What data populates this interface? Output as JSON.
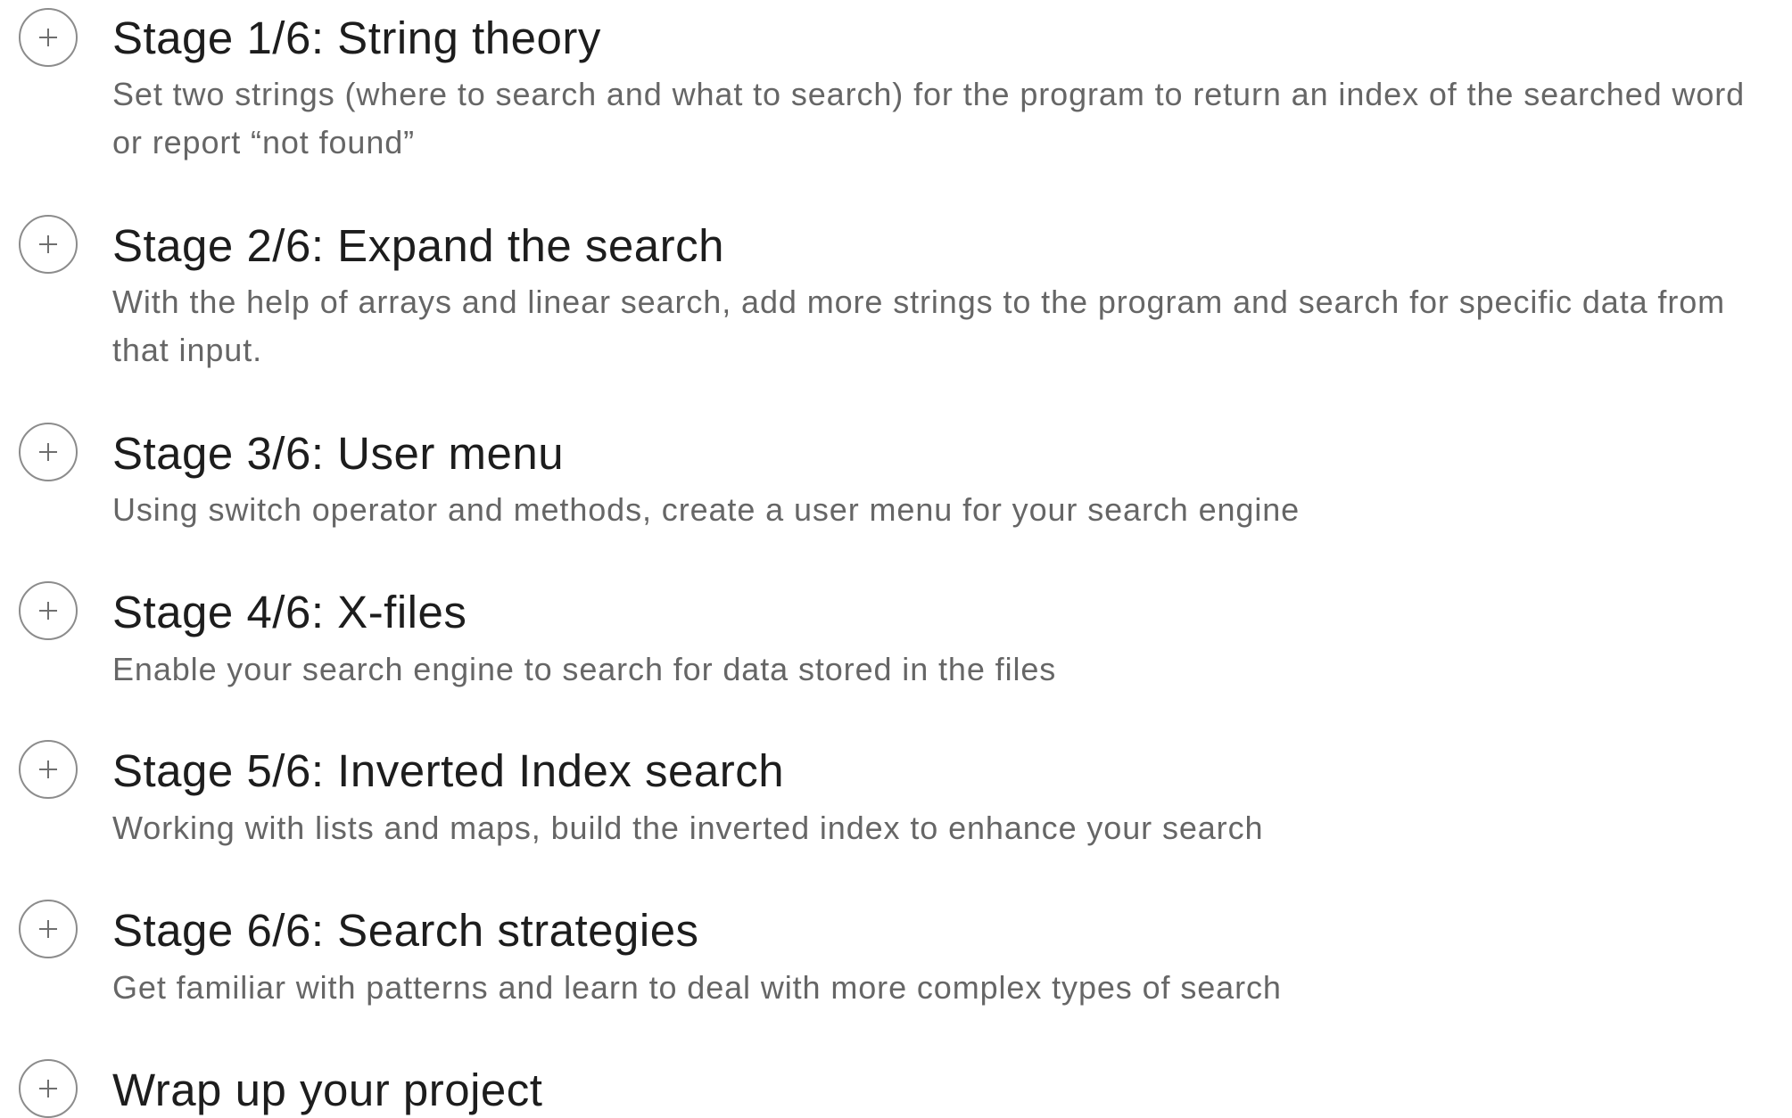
{
  "stages": [
    {
      "title": "Stage 1/6: String theory",
      "description": "Set two strings (where to search and what to search) for the program to return an index of the searched word or report “not found”",
      "toggle_icon": "plus-icon"
    },
    {
      "title": "Stage 2/6: Expand the search",
      "description": "With the help of arrays and linear search, add more strings to the program and search for specific data from that input.",
      "toggle_icon": "plus-icon"
    },
    {
      "title": "Stage 3/6: User menu",
      "description": "Using switch operator and methods, create a user menu for your search engine",
      "toggle_icon": "plus-icon"
    },
    {
      "title": "Stage 4/6: X-files",
      "description": "Enable your search engine to search for data stored in the files",
      "toggle_icon": "plus-icon"
    },
    {
      "title": "Stage 5/6: Inverted Index search",
      "description": "Working with lists and maps, build the inverted index to enhance your search",
      "toggle_icon": "plus-icon"
    },
    {
      "title": "Stage 6/6: Search strategies",
      "description": "Get familiar with patterns and learn to deal with more complex types of search",
      "toggle_icon": "plus-icon"
    },
    {
      "title": "Wrap up your project",
      "toggle_icon": "plus-icon"
    }
  ]
}
